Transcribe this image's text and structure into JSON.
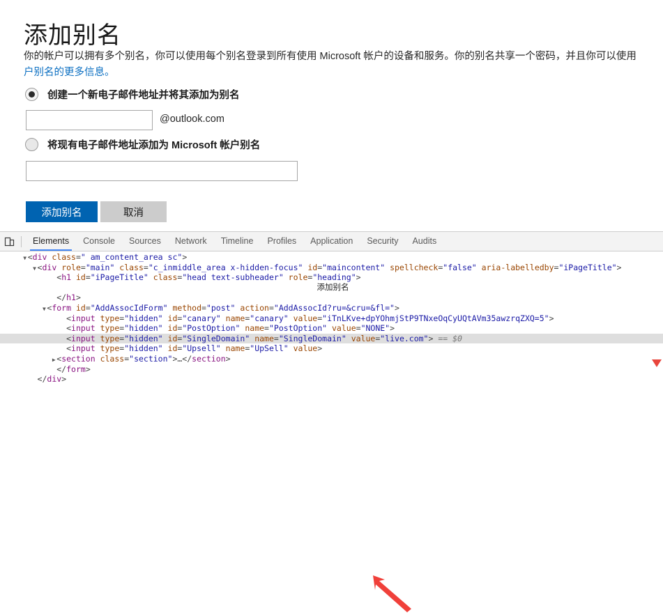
{
  "page": {
    "title": "添加别名",
    "description_line1": "你的帐户可以拥有多个别名，你可以使用每个别名登录到所有使用 Microsoft 帐户的设备和服务。你的别名共享一个密码，并且你可以使用",
    "description_link": "户别名的更多信息。",
    "options": [
      {
        "id": "create-new",
        "label": "创建一个新电子邮件地址并将其添加为别名",
        "selected": true
      },
      {
        "id": "add-existing",
        "label": "将现有电子邮件地址添加为 Microsoft 帐户别名",
        "selected": false
      }
    ],
    "alias_input": {
      "value": "",
      "placeholder": ""
    },
    "domain_suffix": "@outlook.com",
    "existing_input": {
      "value": "",
      "placeholder": ""
    },
    "buttons": {
      "submit": "添加别名",
      "cancel": "取消"
    },
    "colors": {
      "primary": "#0063b1",
      "link": "#0b6fc2",
      "cancel_bg": "#cccccc"
    }
  },
  "devtools": {
    "device_toggle_icon": "device-toolbar-icon",
    "tabs": [
      {
        "label": "Elements",
        "active": true
      },
      {
        "label": "Console",
        "active": false
      },
      {
        "label": "Sources",
        "active": false
      },
      {
        "label": "Network",
        "active": false
      },
      {
        "label": "Timeline",
        "active": false
      },
      {
        "label": "Profiles",
        "active": false
      },
      {
        "label": "Application",
        "active": false
      },
      {
        "label": "Security",
        "active": false
      },
      {
        "label": "Audits",
        "active": false
      }
    ],
    "dom_lines": [
      {
        "indent": 2,
        "twisty": "▼",
        "selected": false,
        "segments": [
          {
            "t": "punc",
            "s": "<"
          },
          {
            "t": "tag",
            "s": "div"
          },
          {
            "t": "attr",
            "s": " class"
          },
          {
            "t": "punc",
            "s": "="
          },
          {
            "t": "val",
            "s": "\" am_content_area sc\""
          },
          {
            "t": "punc",
            "s": ">"
          }
        ]
      },
      {
        "indent": 3,
        "twisty": "▼",
        "selected": false,
        "segments": [
          {
            "t": "punc",
            "s": "<"
          },
          {
            "t": "tag",
            "s": "div"
          },
          {
            "t": "attr",
            "s": " role"
          },
          {
            "t": "punc",
            "s": "="
          },
          {
            "t": "val",
            "s": "\"main\""
          },
          {
            "t": "attr",
            "s": " class"
          },
          {
            "t": "punc",
            "s": "="
          },
          {
            "t": "val",
            "s": "\"c_inmiddle_area x-hidden-focus\""
          },
          {
            "t": "attr",
            "s": " id"
          },
          {
            "t": "punc",
            "s": "="
          },
          {
            "t": "val",
            "s": "\"maincontent\""
          },
          {
            "t": "attr",
            "s": " spellcheck"
          },
          {
            "t": "punc",
            "s": "="
          },
          {
            "t": "val",
            "s": "\"false\""
          },
          {
            "t": "attr",
            "s": " aria-labelledby"
          },
          {
            "t": "punc",
            "s": "="
          },
          {
            "t": "val",
            "s": "\"iPageTitle\""
          },
          {
            "t": "punc",
            "s": ">"
          }
        ]
      },
      {
        "indent": 5,
        "twisty": "",
        "selected": false,
        "segments": [
          {
            "t": "punc",
            "s": "<"
          },
          {
            "t": "tag",
            "s": "h1"
          },
          {
            "t": "attr",
            "s": " id"
          },
          {
            "t": "punc",
            "s": "="
          },
          {
            "t": "val",
            "s": "\"iPageTitle\""
          },
          {
            "t": "attr",
            "s": " class"
          },
          {
            "t": "punc",
            "s": "="
          },
          {
            "t": "val",
            "s": "\"head text-subheader\""
          },
          {
            "t": "attr",
            "s": " role"
          },
          {
            "t": "punc",
            "s": "="
          },
          {
            "t": "val",
            "s": "\"heading\""
          },
          {
            "t": "punc",
            "s": ">"
          }
        ]
      },
      {
        "indent": 0,
        "twisty": "",
        "selected": false,
        "center_text": "添加别名",
        "segments": []
      },
      {
        "indent": 5,
        "twisty": "",
        "selected": false,
        "segments": [
          {
            "t": "punc",
            "s": "</"
          },
          {
            "t": "tag",
            "s": "h1"
          },
          {
            "t": "punc",
            "s": ">"
          }
        ]
      },
      {
        "indent": 4,
        "twisty": "▼",
        "selected": false,
        "segments": [
          {
            "t": "punc",
            "s": "<"
          },
          {
            "t": "tag",
            "s": "form"
          },
          {
            "t": "attr",
            "s": " id"
          },
          {
            "t": "punc",
            "s": "="
          },
          {
            "t": "val",
            "s": "\"AddAssocIdForm\""
          },
          {
            "t": "attr",
            "s": " method"
          },
          {
            "t": "punc",
            "s": "="
          },
          {
            "t": "val",
            "s": "\"post\""
          },
          {
            "t": "attr",
            "s": " action"
          },
          {
            "t": "punc",
            "s": "="
          },
          {
            "t": "val",
            "s": "\"AddAssocId?ru=&cru=&fl=\""
          },
          {
            "t": "punc",
            "s": ">"
          }
        ]
      },
      {
        "indent": 6,
        "twisty": "",
        "selected": false,
        "segments": [
          {
            "t": "punc",
            "s": "<"
          },
          {
            "t": "tag",
            "s": "input"
          },
          {
            "t": "attr",
            "s": " type"
          },
          {
            "t": "punc",
            "s": "="
          },
          {
            "t": "val",
            "s": "\"hidden\""
          },
          {
            "t": "attr",
            "s": " id"
          },
          {
            "t": "punc",
            "s": "="
          },
          {
            "t": "val",
            "s": "\"canary\""
          },
          {
            "t": "attr",
            "s": " name"
          },
          {
            "t": "punc",
            "s": "="
          },
          {
            "t": "val",
            "s": "\"canary\""
          },
          {
            "t": "attr",
            "s": " value"
          },
          {
            "t": "punc",
            "s": "="
          },
          {
            "t": "val",
            "s": "\"iTnLKve+dpYOhmjStP9TNxeOqCyUQtAVm35awzrqZXQ=5\""
          },
          {
            "t": "punc",
            "s": ">"
          }
        ]
      },
      {
        "indent": 6,
        "twisty": "",
        "selected": false,
        "segments": [
          {
            "t": "punc",
            "s": "<"
          },
          {
            "t": "tag",
            "s": "input"
          },
          {
            "t": "attr",
            "s": " type"
          },
          {
            "t": "punc",
            "s": "="
          },
          {
            "t": "val",
            "s": "\"hidden\""
          },
          {
            "t": "attr",
            "s": " id"
          },
          {
            "t": "punc",
            "s": "="
          },
          {
            "t": "val",
            "s": "\"PostOption\""
          },
          {
            "t": "attr",
            "s": " name"
          },
          {
            "t": "punc",
            "s": "="
          },
          {
            "t": "val",
            "s": "\"PostOption\""
          },
          {
            "t": "attr",
            "s": " value"
          },
          {
            "t": "punc",
            "s": "="
          },
          {
            "t": "val",
            "s": "\"NONE\""
          },
          {
            "t": "punc",
            "s": ">"
          }
        ]
      },
      {
        "indent": 6,
        "twisty": "",
        "selected": true,
        "segments": [
          {
            "t": "punc",
            "s": "<"
          },
          {
            "t": "tag",
            "s": "input"
          },
          {
            "t": "attr",
            "s": " type"
          },
          {
            "t": "punc",
            "s": "="
          },
          {
            "t": "val",
            "s": "\"hidden\""
          },
          {
            "t": "attr",
            "s": " id"
          },
          {
            "t": "punc",
            "s": "="
          },
          {
            "t": "val",
            "s": "\"SingleDomain\""
          },
          {
            "t": "attr",
            "s": " name"
          },
          {
            "t": "punc",
            "s": "="
          },
          {
            "t": "val",
            "s": "\"SingleDomain\""
          },
          {
            "t": "attr",
            "s": " value"
          },
          {
            "t": "punc",
            "s": "="
          },
          {
            "t": "val",
            "s": "\"live.com\""
          },
          {
            "t": "punc",
            "s": ">"
          },
          {
            "t": "sel0",
            "s": " == $0"
          }
        ]
      },
      {
        "indent": 6,
        "twisty": "",
        "selected": false,
        "segments": [
          {
            "t": "punc",
            "s": "<"
          },
          {
            "t": "tag",
            "s": "input"
          },
          {
            "t": "attr",
            "s": " type"
          },
          {
            "t": "punc",
            "s": "="
          },
          {
            "t": "val",
            "s": "\"hidden\""
          },
          {
            "t": "attr",
            "s": " id"
          },
          {
            "t": "punc",
            "s": "="
          },
          {
            "t": "val",
            "s": "\"Upsell\""
          },
          {
            "t": "attr",
            "s": " name"
          },
          {
            "t": "punc",
            "s": "="
          },
          {
            "t": "val",
            "s": "\"UpSell\""
          },
          {
            "t": "attr",
            "s": " value"
          },
          {
            "t": "punc",
            "s": ">"
          }
        ]
      },
      {
        "indent": 5,
        "twisty": "▶",
        "selected": false,
        "segments": [
          {
            "t": "punc",
            "s": "<"
          },
          {
            "t": "tag",
            "s": "section"
          },
          {
            "t": "attr",
            "s": " class"
          },
          {
            "t": "punc",
            "s": "="
          },
          {
            "t": "val",
            "s": "\"section\""
          },
          {
            "t": "punc",
            "s": ">…</"
          },
          {
            "t": "tag",
            "s": "section"
          },
          {
            "t": "punc",
            "s": ">"
          }
        ]
      },
      {
        "indent": 5,
        "twisty": "",
        "selected": false,
        "segments": [
          {
            "t": "punc",
            "s": "</"
          },
          {
            "t": "tag",
            "s": "form"
          },
          {
            "t": "punc",
            "s": ">"
          }
        ]
      },
      {
        "indent": 3,
        "twisty": "",
        "selected": false,
        "segments": [
          {
            "t": "punc",
            "s": "</"
          },
          {
            "t": "tag",
            "s": "div"
          },
          {
            "t": "punc",
            "s": ">"
          }
        ]
      }
    ],
    "annotation": {
      "type": "red-arrow",
      "color": "#e8453c",
      "points_to": "live.com"
    }
  }
}
